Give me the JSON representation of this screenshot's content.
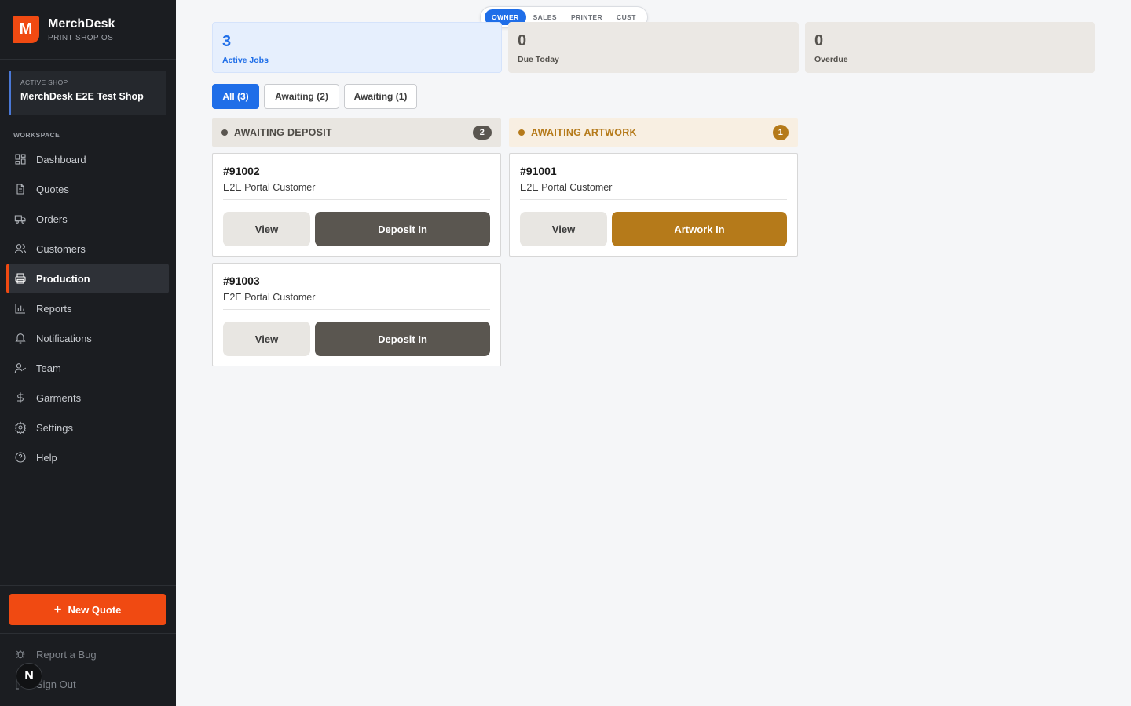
{
  "brand": {
    "logo_letter": "M",
    "name": "MerchDesk",
    "subtitle": "PRINT SHOP OS"
  },
  "active_shop": {
    "label": "ACTIVE SHOP",
    "name": "MerchDesk E2E Test Shop"
  },
  "nav": {
    "section_label": "WORKSPACE",
    "items": [
      {
        "label": "Dashboard",
        "icon": "dashboard-icon"
      },
      {
        "label": "Quotes",
        "icon": "document-icon"
      },
      {
        "label": "Orders",
        "icon": "truck-icon"
      },
      {
        "label": "Customers",
        "icon": "users-icon"
      },
      {
        "label": "Production",
        "icon": "printer-icon",
        "active": true
      },
      {
        "label": "Reports",
        "icon": "bar-chart-icon"
      },
      {
        "label": "Notifications",
        "icon": "bell-icon"
      },
      {
        "label": "Team",
        "icon": "user-check-icon"
      },
      {
        "label": "Garments",
        "icon": "dollar-icon"
      },
      {
        "label": "Settings",
        "icon": "gear-icon"
      },
      {
        "label": "Help",
        "icon": "help-circle-icon"
      }
    ]
  },
  "sidebar_bottom": {
    "new_quote": "New Quote",
    "report_bug": "Report a Bug",
    "sign_out": "Sign Out",
    "badge_letter": "N"
  },
  "roles": {
    "items": [
      "OWNER",
      "SALES",
      "PRINTER",
      "CUST"
    ],
    "active": "OWNER"
  },
  "stats": [
    {
      "value": "3",
      "label": "Active Jobs"
    },
    {
      "value": "0",
      "label": "Due Today"
    },
    {
      "value": "0",
      "label": "Overdue"
    }
  ],
  "filters": [
    {
      "label": "All (3)",
      "active": true
    },
    {
      "label": "Awaiting (2)"
    },
    {
      "label": "Awaiting (1)"
    }
  ],
  "columns": [
    {
      "title": "AWAITING DEPOSIT",
      "count": "2",
      "color": "#5a5650",
      "cards": [
        {
          "id": "#91002",
          "customer": "E2E Portal Customer",
          "view_label": "View",
          "action_label": "Deposit In"
        },
        {
          "id": "#91003",
          "customer": "E2E Portal Customer",
          "view_label": "View",
          "action_label": "Deposit In"
        }
      ]
    },
    {
      "title": "AWAITING ARTWORK",
      "count": "1",
      "color": "#b57a1a",
      "cards": [
        {
          "id": "#91001",
          "customer": "E2E Portal Customer",
          "view_label": "View",
          "action_label": "Artwork In"
        }
      ]
    }
  ],
  "colors": {
    "accent_orange": "#f04a12",
    "primary_blue": "#1f6ee8",
    "sidebar_bg": "#1b1d21"
  }
}
